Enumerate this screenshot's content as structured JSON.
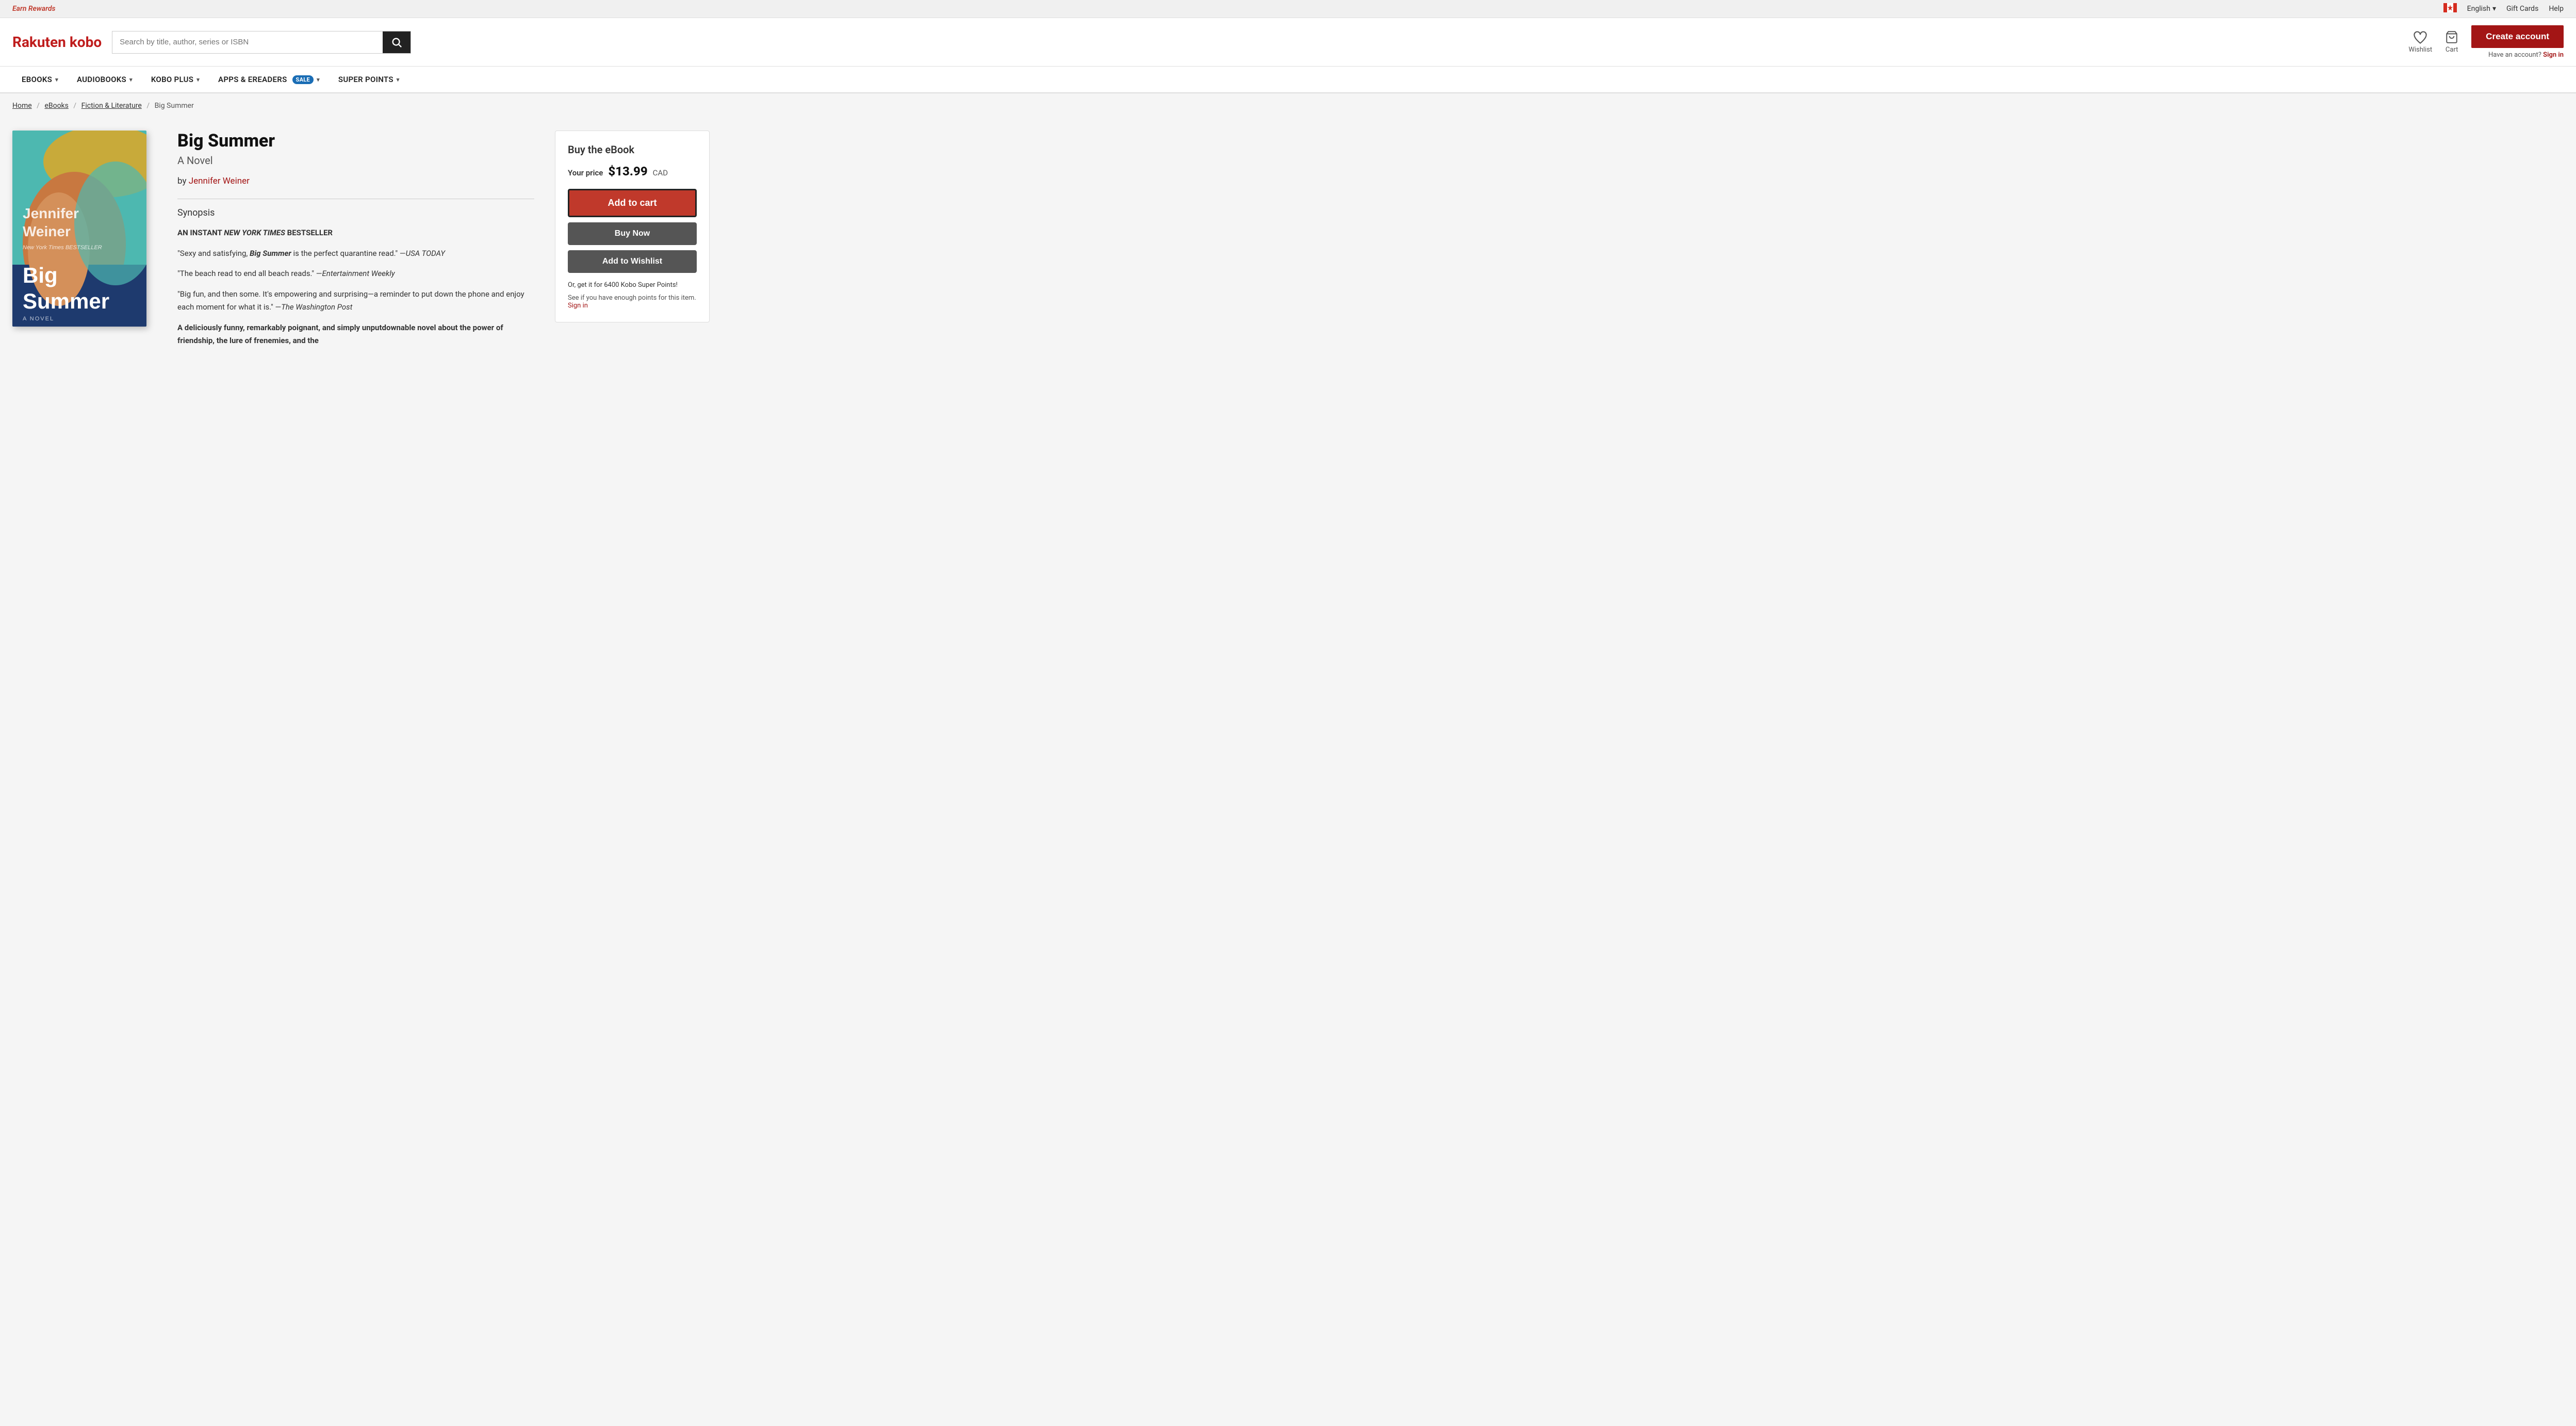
{
  "topbar": {
    "earn_rewards": "Earn Rewards",
    "language": "English",
    "gift_cards": "Gift Cards",
    "help": "Help"
  },
  "header": {
    "logo": "Rakuten kobo",
    "search_placeholder": "Search by title, author, series or ISBN",
    "wishlist_label": "Wishlist",
    "cart_label": "Cart",
    "create_account": "Create account",
    "have_account": "Have an account?",
    "sign_in": "Sign in"
  },
  "nav": {
    "items": [
      {
        "label": "eBOOKS",
        "has_chevron": true,
        "sale": false
      },
      {
        "label": "AUDIOBOOKS",
        "has_chevron": true,
        "sale": false
      },
      {
        "label": "KOBO PLUS",
        "has_chevron": true,
        "sale": false
      },
      {
        "label": "APPS & eREADERS",
        "has_chevron": true,
        "sale": true,
        "sale_label": "SALE"
      },
      {
        "label": "SUPER POINTS",
        "has_chevron": true,
        "sale": false
      }
    ]
  },
  "breadcrumb": {
    "home": "Home",
    "ebooks": "eBooks",
    "fiction": "Fiction & Literature",
    "current": "Big Summer"
  },
  "book": {
    "title": "Big Summer",
    "subtitle": "A Novel",
    "author_prefix": "by",
    "author": "Jennifer Weiner",
    "synopsis_label": "Synopsis",
    "synopsis": [
      "AN INSTANT NEW YORK TIMES BESTSELLER",
      "\"Sexy and satisfying, Big Summer is the perfect quarantine read.\" —USA TODAY",
      "\"The beach read to end all beach reads.\" —Entertainment Weekly",
      "\"Big fun, and then some. It's empowering and surprising—a reminder to put down the phone and enjoy each moment for what it is.\" —The Washington Post",
      "A deliciously funny, remarkably poignant, and simply unputdownable novel about the power of friendship, the lure of frenemies, and the"
    ],
    "cover": {
      "author": "Jennifer\nWeiner",
      "nyt": "New York Times BESTSELLER",
      "title": "Big\nSummer",
      "novel": "A NOVEL"
    }
  },
  "buy_panel": {
    "title": "Buy the eBook",
    "price_label": "Your price",
    "price": "$13.99",
    "currency": "CAD",
    "add_to_cart": "Add to cart",
    "buy_now": "Buy Now",
    "add_wishlist": "Add to Wishlist",
    "super_points": "Or, get it for 6400 Kobo Super Points!",
    "see_if": "See if you have enough points for this item.",
    "sign_in": "Sign in"
  }
}
